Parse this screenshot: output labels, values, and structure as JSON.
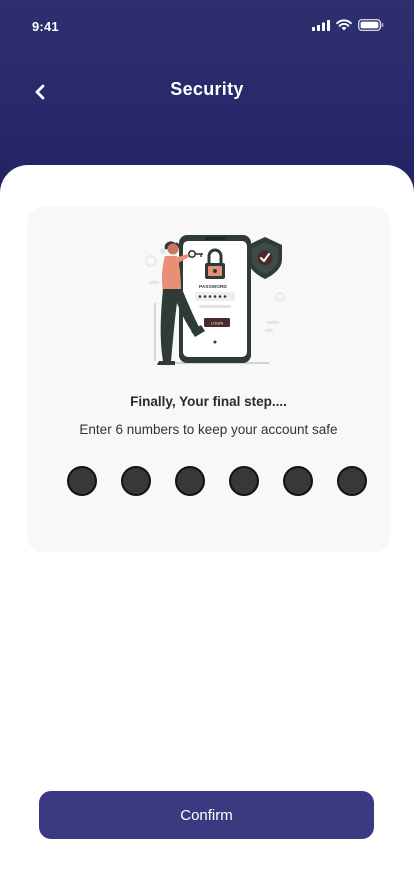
{
  "status_bar": {
    "time": "9:41"
  },
  "header": {
    "title": "Security"
  },
  "card": {
    "heading": "Finally, Your final step....",
    "subtitle": "Enter 6 numbers to keep your account safe",
    "illustration": {
      "password_label": "PASSWORD",
      "login_label": "LOGIN"
    },
    "pin_length": 6
  },
  "confirm_label": "Confirm",
  "colors": {
    "header_bg": "#27296b",
    "button_bg": "#3b3a80",
    "card_bg": "#f8f8f8",
    "pin_dot": "#383838",
    "illustration_accent": "#e88f77",
    "illustration_dark": "#2e3b36"
  },
  "icons": {
    "back": "chevron-left-icon",
    "signal": "signal-icon",
    "wifi": "wifi-icon",
    "battery": "battery-icon",
    "lock": "lock-icon",
    "shield": "shield-check-icon"
  }
}
